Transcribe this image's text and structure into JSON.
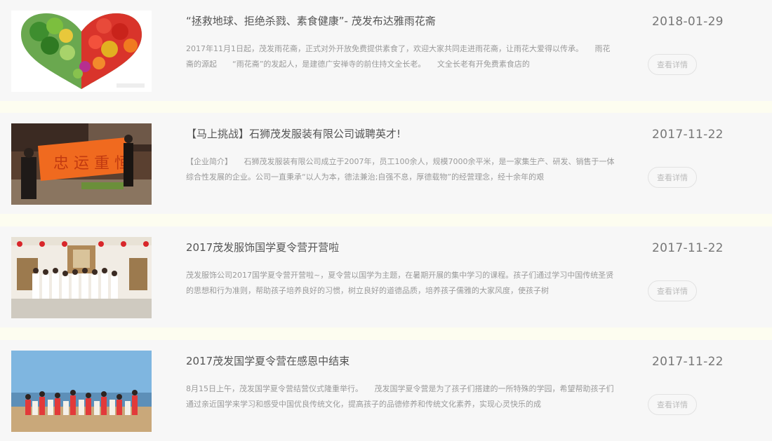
{
  "articles": [
    {
      "title": "“拯救地球、拒绝杀戮、素食健康”- 茂发布达雅雨花斋",
      "excerpt": "2017年11月1日起，茂发雨花斋，正式对外开放免费提供素食了，欢迎大家共同走进雨花斋，让雨花大爱得以传承。　　雨花斋的源起　　“雨花斋”的发起人，是建德广安禅寺的前住持文全长老。　　文全长老有开免费素食店的",
      "date": "2018-01-29",
      "detail_label": "查看详情",
      "image_icon": "vegetable-heart-photo"
    },
    {
      "title": "【马上挑战】石狮茂发服装有限公司诚聘英才!",
      "excerpt": "【企业简介】　　石狮茂发服装有限公司成立于2007年，员工100余人，规模7000余平米，是一家集生产、研发、销售于一体综合性发展的企业。公司一直秉承“以人为本，德法兼治;自强不息，厚德载物”的经营理念，经十余年的艰",
      "date": "2017-11-22",
      "detail_label": "查看详情",
      "image_icon": "banner-photo"
    },
    {
      "title": "2017茂发服饰国学夏令营开营啦",
      "excerpt": "茂发服饰公司2017国学夏令营开营啦~，夏令营以国学为主题，在暑期开展的集中学习的课程。孩子们通过学习中国传统圣贤的思想和行为准则，帮助孩子培养良好的习惯，树立良好的道德品质，培养孩子儒雅的大家风度，使孩子树",
      "date": "2017-11-22",
      "detail_label": "查看详情",
      "image_icon": "children-group-photo"
    },
    {
      "title": "2017茂发国学夏令营在感恩中结束",
      "excerpt": "8月15日上午，茂发国学夏令营结营仪式隆重举行。　　茂发国学夏令营是为了孩子们搭建的一所特殊的学园，希望帮助孩子们通过亲近国学来学习和感受中国优良传统文化，提高孩子的品德修养和传统文化素养，实现心灵快乐的成",
      "date": "2017-11-22",
      "detail_label": "查看详情",
      "image_icon": "beach-group-photo"
    }
  ],
  "colors": {
    "card_bg": "#f7f7f7",
    "page_bg": "#fdfdf0",
    "title": "#555555",
    "excerpt": "#9a9a9a",
    "date": "#777777",
    "button_border": "#e2e2e2",
    "button_text": "#bbbbbb"
  }
}
